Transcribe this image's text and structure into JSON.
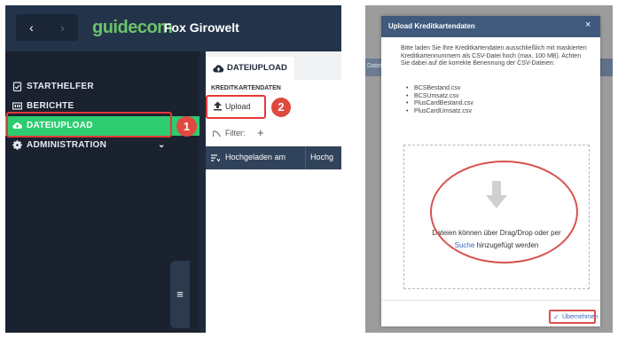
{
  "left": {
    "nav": {
      "back": "‹",
      "forward": "›"
    },
    "logo": {
      "prefix": "guide",
      "suffix": "com"
    },
    "company": "Fox Girowelt",
    "sidebar": {
      "items": [
        {
          "label": "STARTHELFER"
        },
        {
          "label": "BERICHTE"
        },
        {
          "label": "DATEIUPLOAD"
        },
        {
          "label": "ADMINISTRATION"
        }
      ]
    },
    "badges": {
      "one": "1",
      "two": "2"
    },
    "tab": {
      "label": "DATEIUPLOAD"
    },
    "panel": {
      "section": "KREDITKARTENDATEN",
      "upload": "Upload",
      "filter": "Filter:",
      "add": "+",
      "columns": [
        "Hochgeladen am",
        "Hochg"
      ]
    }
  },
  "right": {
    "bg_label": "Dateinam",
    "dialog": {
      "title": "Upload Kreditkartendaten",
      "close": "×",
      "text": "Bitte laden Sie Ihre Kreditkartendaten ausschließlich mit maskierten Kreditkartennummern als CSV-Datei hoch (max. 100 MB). Achten Sie dabei auf die korrekte Benennung der CSV-Dateien:",
      "files": [
        "BCSBestand.csv",
        "BCSUmsatz.csv",
        "PlusCardBestand.csv",
        "PlusCardUmsatz.csv"
      ],
      "drop_text_1": "Dateien können über Drag/Drop oder per",
      "drop_link": "Suche",
      "drop_text_2": "hinzugefügt werden",
      "ok": "Übernehmen"
    }
  },
  "colors": {
    "accent_green": "#2ecc71",
    "highlight_red": "#e53935",
    "link_blue": "#3a66b5",
    "sidebar_bg": "#1a2230",
    "dialog_header": "#3f5a7c"
  },
  "icons": [
    "chevron-left-icon",
    "chevron-right-icon",
    "clipboard-icon",
    "report-icon",
    "cloud-upload-icon",
    "gear-icon",
    "chevron-down-icon",
    "hamburger-icon",
    "upload-icon",
    "filter-icon",
    "sort-icon",
    "arrow-down-icon",
    "check-icon",
    "close-icon"
  ]
}
